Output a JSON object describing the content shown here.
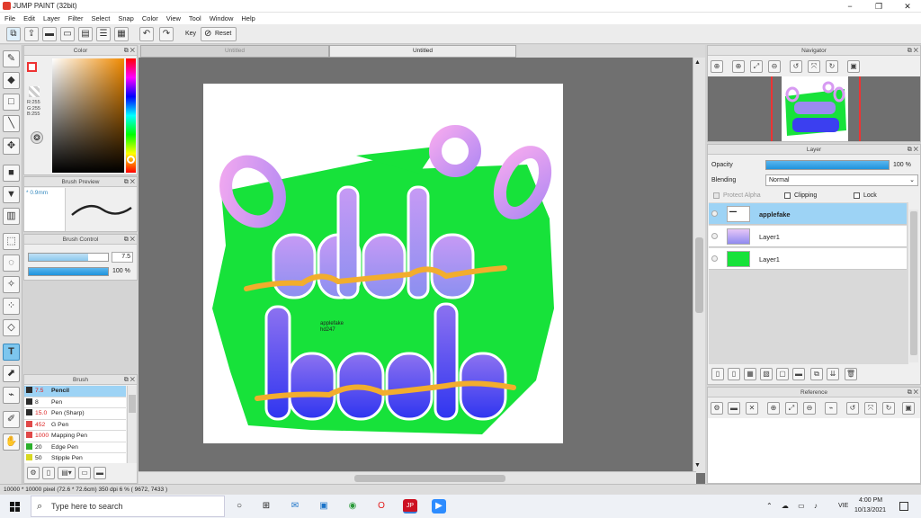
{
  "app": {
    "title": "JUMP PAINT (32bit)"
  },
  "window_controls": {
    "minimize": "−",
    "maximize": "❐",
    "close": "✕"
  },
  "menu": [
    "File",
    "Edit",
    "Layer",
    "Filter",
    "Select",
    "Snap",
    "Color",
    "View",
    "Tool",
    "Window",
    "Help"
  ],
  "toolbar": {
    "key_label": "Key",
    "reset_label": "Reset"
  },
  "doc_tabs": [
    "Untitled",
    "Untitled"
  ],
  "color_panel": {
    "title": "Color",
    "r": "R:255",
    "g": "G:255",
    "b": "B:255"
  },
  "brush_preview": {
    "title": "Brush Preview",
    "size": "* 0.9mm"
  },
  "brush_control": {
    "title": "Brush Control",
    "size_value": "7.5",
    "opacity_value": "100 %",
    "size_fraction": 0.75,
    "opacity_fraction": 1.0
  },
  "brush_panel": {
    "title": "Brush",
    "items": [
      {
        "size": "7.5",
        "name": "Pencil",
        "color": "#2b2b2b",
        "selected": true
      },
      {
        "size": "8",
        "name": "Pen",
        "color": "#2b2b2b"
      },
      {
        "size": "15.0",
        "name": "Pen (Sharp)",
        "color": "#2b2b2b"
      },
      {
        "size": "452",
        "name": "G Pen",
        "color": "#e04848"
      },
      {
        "size": "1000",
        "name": "Mapping Pen",
        "color": "#e04848"
      },
      {
        "size": "20",
        "name": "Edge Pen",
        "color": "#2cb02c"
      },
      {
        "size": "50",
        "name": "Stipple Pen",
        "color": "#d8d820"
      }
    ]
  },
  "navigator": {
    "title": "Navigator"
  },
  "layer_panel": {
    "title": "Layer",
    "opacity_label": "Opacity",
    "opacity_value": "100 %",
    "opacity_fraction": 1.0,
    "blending_label": "Blending",
    "blending_value": "Normal",
    "protect_alpha": "Protect Alpha",
    "clipping": "Clipping",
    "lock": "Lock",
    "layers": [
      {
        "name": "applefake",
        "selected": true
      },
      {
        "name": "Layer1"
      },
      {
        "name": "Layer1"
      }
    ]
  },
  "reference": {
    "title": "Reference"
  },
  "canvas_text": {
    "line1": "applefake",
    "line2": "hd247"
  },
  "status": {
    "text": "10000 * 10000 pixel   (72.6 * 72.6cm)   350 dpi   6 %   ( 9672, 7433 )"
  },
  "taskbar": {
    "search_placeholder": "Type here to search",
    "time": "4:00 PM",
    "date": "10/13/2021",
    "lang": "VIE"
  },
  "colors": {
    "accent": "#7dc6ee",
    "green": "#17e23a",
    "purple": "#9b7cf0",
    "blue": "#3b3ff0",
    "orange": "#f2ad2d"
  }
}
